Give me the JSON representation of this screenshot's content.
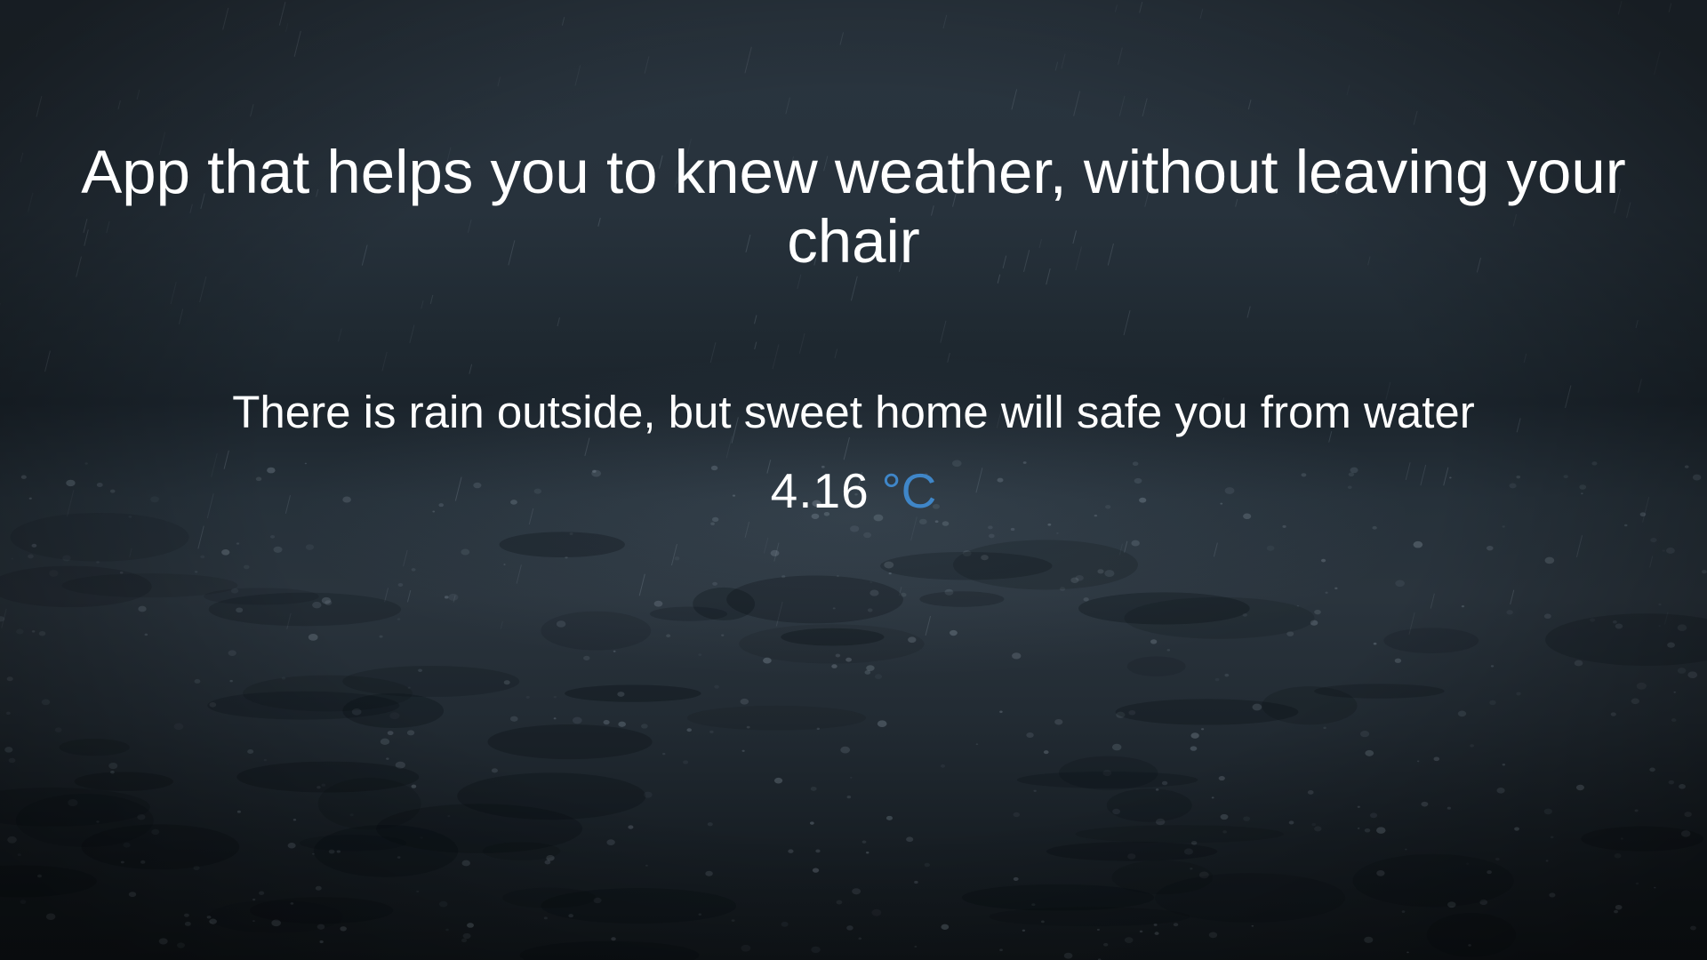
{
  "headline": "App that helps you to knew weather, without leaving your chair",
  "message": "There is rain outside, but sweet home will safe you from water",
  "temperature": {
    "value": "4.16",
    "unit": "°C"
  },
  "colors": {
    "text": "#ffffff",
    "unit_accent": "#3f86c8",
    "background": "#1e2730"
  }
}
